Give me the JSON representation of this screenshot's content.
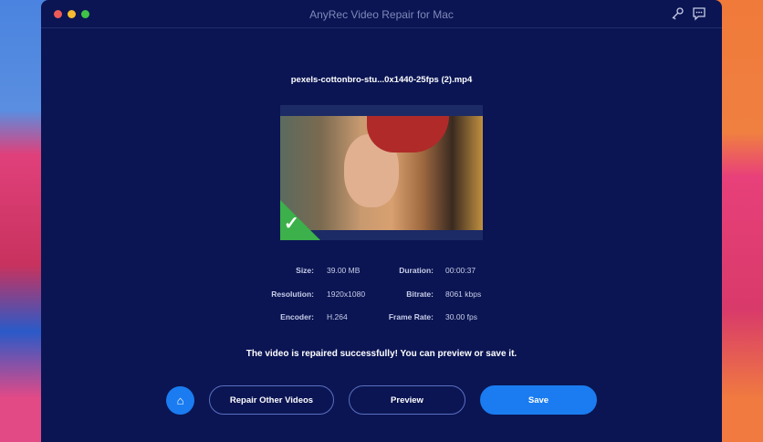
{
  "window": {
    "title": "AnyRec Video Repair for Mac",
    "colors": {
      "close": "#ee5b57",
      "minimize": "#f5bc2f",
      "zoom": "#3fc446"
    }
  },
  "file": {
    "name": "pexels-cottonbro-stu...0x1440-25fps (2).mp4",
    "status_icon": "check-icon"
  },
  "info": [
    {
      "label": "Size:",
      "value": "39.00 MB"
    },
    {
      "label": "Duration:",
      "value": "00:00:37"
    },
    {
      "label": "Resolution:",
      "value": "1920x1080"
    },
    {
      "label": "Bitrate:",
      "value": "8061 kbps"
    },
    {
      "label": "Encoder:",
      "value": "H.264"
    },
    {
      "label": "Frame Rate:",
      "value": "30.00 fps"
    }
  ],
  "message": "The video is repaired successfully! You can preview or save it.",
  "buttons": {
    "repair_other": "Repair Other Videos",
    "preview": "Preview",
    "save": "Save"
  },
  "accent": "#1a7cf0"
}
